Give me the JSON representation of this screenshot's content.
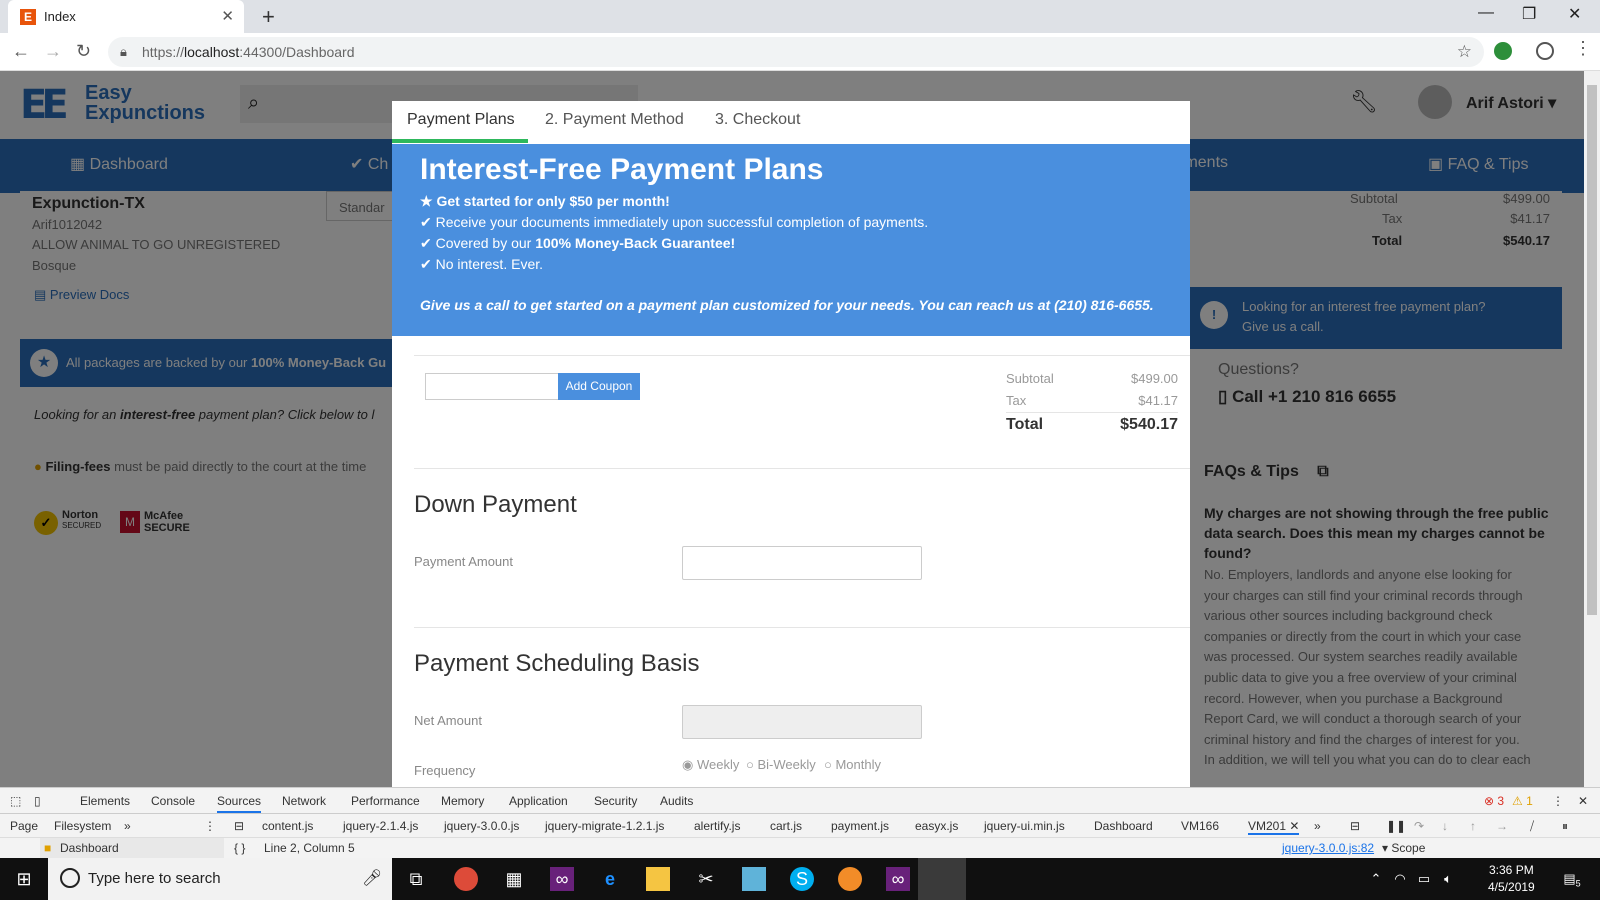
{
  "browser": {
    "tab_title": "Index",
    "tab_favicon": "E",
    "url_prefix": "https://",
    "url_host": "localhost",
    "url_rest": ":44300/Dashboard"
  },
  "site": {
    "logo_mark": "EE",
    "logo_line1": "Easy",
    "logo_line2": "Expunctions",
    "user_name": "Arif Astori",
    "nav": [
      "Dashboard",
      "Ch",
      "tallments",
      "FAQ & Tips"
    ]
  },
  "left_panel": {
    "case_title": "Expunction-TX",
    "case_id": "Arif1012042",
    "charge": "ALLOW ANIMAL TO GO UNREGISTERED",
    "county": "Bosque",
    "select_value": "Standar",
    "preview_docs": "Preview Docs",
    "guarantee_prefix": "All packages are backed by our",
    "guarantee_bold": "100% Money-Back Gu",
    "looking_prefix": "Looking for an",
    "looking_bold": "interest-free",
    "looking_suffix": "payment plan? Click below to l",
    "filing_bold": "Filing-fees",
    "filing_text": "must be paid directly to the court at the time",
    "norton": "Norton",
    "norton_sub": "SECURED",
    "mcafee": "McAfee",
    "mcafee_sub": "SECURE"
  },
  "right_panel": {
    "subtotal_label": "Subtotal",
    "subtotal_value": "$499.00",
    "tax_label": "Tax",
    "tax_value": "$41.17",
    "total_label": "Total",
    "total_value": "$540.17",
    "promo_line1": "Looking for an interest free payment plan?",
    "promo_line2": "Give us a call.",
    "questions": "Questions?",
    "call": "Call +1 210 816 6655"
  },
  "faq": {
    "title": "FAQs & Tips",
    "question": [
      "My charges are not showing through the free public",
      "data search. Does this mean my charges cannot be",
      "found?"
    ],
    "answer": [
      "No. Employers, landlords and anyone else looking for",
      "your charges can still find your criminal records through",
      "various other sources including background check",
      "companies or directly from the court in which your case",
      "was processed. Our system searches readily available",
      "public data to give you a free overview of your criminal",
      "record. However, when you purchase a Background",
      "Report Card, we will conduct a thorough search of your",
      "criminal history and find the charges of interest for you.",
      "In addition, we will tell you what you can do to clear each"
    ]
  },
  "modal": {
    "tabs": [
      "Payment Plans",
      "2. Payment Method",
      "3. Checkout"
    ],
    "banner_title": "Interest-Free Payment Plans",
    "b1": "Get started for only $50 per month!",
    "b2": "Receive your documents immediately upon successful completion of payments.",
    "b3_prefix": "Covered by our",
    "b3_bold": "100% Money-Back Guarantee!",
    "b4": "No interest. Ever.",
    "call_prefix": "Give us a call to get started on a payment plan customized for your needs. You can reach us at",
    "call_phone": "(210) 816-6655.",
    "coupon_btn": "Add Coupon",
    "subtotal_label": "Subtotal",
    "subtotal_value": "$499.00",
    "tax_label": "Tax",
    "tax_value": "$41.17",
    "total_label": "Total",
    "total_value": "$540.17",
    "down_payment_heading": "Down Payment",
    "payment_amount_label": "Payment Amount",
    "scheduling_heading": "Payment Scheduling Basis",
    "net_amount_label": "Net Amount",
    "frequency_label": "Frequency",
    "freq_options": [
      "Weekly",
      "Bi-Weekly",
      "Monthly"
    ],
    "freq_selected": "Weekly"
  },
  "devtools": {
    "tabs": [
      "Elements",
      "Console",
      "Sources",
      "Network",
      "Performance",
      "Memory",
      "Application",
      "Security",
      "Audits"
    ],
    "active_tab": "Sources",
    "errors": "3",
    "warnings": "1",
    "nav_tabs": [
      "Page",
      "Filesystem"
    ],
    "files": [
      "content.js",
      "jquery-2.1.4.js",
      "jquery-3.0.0.js",
      "jquery-migrate-1.2.1.js",
      "alertify.js",
      "cart.js",
      "payment.js",
      "easyx.js",
      "jquery-ui.min.js",
      "Dashboard",
      "VM166",
      "VM201"
    ],
    "tree_item": "Dashboard",
    "position": "Line 2, Column 5",
    "source_link": "jquery-3.0.0.js:82",
    "scope": "Scope"
  },
  "taskbar": {
    "search_placeholder": "Type here to search",
    "time": "3:36 PM",
    "date": "4/5/2019",
    "notif_count": "5"
  }
}
